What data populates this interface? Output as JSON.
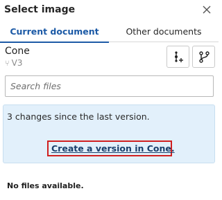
{
  "dialog": {
    "title": "Select image"
  },
  "tabs": [
    {
      "label": "Current document",
      "active": true
    },
    {
      "label": "Other documents",
      "active": false
    }
  ],
  "document": {
    "name": "Cone",
    "version": "V3"
  },
  "search": {
    "placeholder": "Search files",
    "value": ""
  },
  "info": {
    "message": "3 changes since the last version.",
    "link_label": "Create a version in Cone."
  },
  "empty_state": "No files available.",
  "colors": {
    "accent": "#1c5aa6",
    "info_background": "#e2f0fb",
    "highlight_border": "#d01f1f"
  },
  "icons": {
    "close": "close-icon",
    "add_version": "add-version-icon",
    "branch": "branch-icon"
  }
}
